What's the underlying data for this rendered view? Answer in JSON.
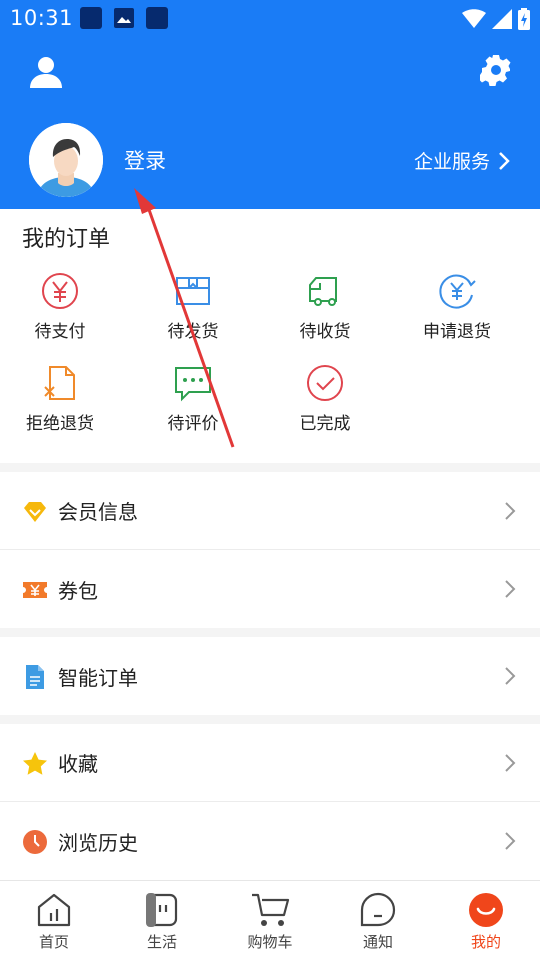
{
  "status_bar": {
    "time": "10:31"
  },
  "header": {
    "login_label": "登录",
    "enterprise_label": "企业服务",
    "chevron": "›"
  },
  "orders": {
    "title": "我的订单",
    "items": [
      {
        "label": "待支付",
        "icon": "yen-circle-icon"
      },
      {
        "label": "待发货",
        "icon": "box-icon"
      },
      {
        "label": "待收货",
        "icon": "truck-icon"
      },
      {
        "label": "申请退货",
        "icon": "refund-icon"
      },
      {
        "label": "拒绝退货",
        "icon": "reject-doc-icon"
      },
      {
        "label": "待评价",
        "icon": "chat-icon"
      },
      {
        "label": "已完成",
        "icon": "check-circle-icon"
      }
    ]
  },
  "menu": {
    "group1": [
      {
        "label": "会员信息",
        "icon": "diamond-icon"
      },
      {
        "label": "券包",
        "icon": "coupon-icon"
      }
    ],
    "group2": [
      {
        "label": "智能订单",
        "icon": "document-icon"
      }
    ],
    "group3": [
      {
        "label": "收藏",
        "icon": "star-icon"
      },
      {
        "label": "浏览历史",
        "icon": "clock-icon"
      }
    ]
  },
  "tabbar": {
    "items": [
      {
        "label": "首页",
        "icon": "home-icon"
      },
      {
        "label": "生活",
        "icon": "life-icon"
      },
      {
        "label": "购物车",
        "icon": "cart-icon"
      },
      {
        "label": "通知",
        "icon": "notification-icon"
      },
      {
        "label": "我的",
        "icon": "profile-icon",
        "active": true
      }
    ]
  },
  "colors": {
    "brand_blue": "#1a7cf6",
    "accent_orange": "#f0461b",
    "order_red": "#e0454e",
    "order_blue": "#3a8ee6",
    "order_green": "#2ea04f",
    "annotation_red": "#e23838"
  }
}
